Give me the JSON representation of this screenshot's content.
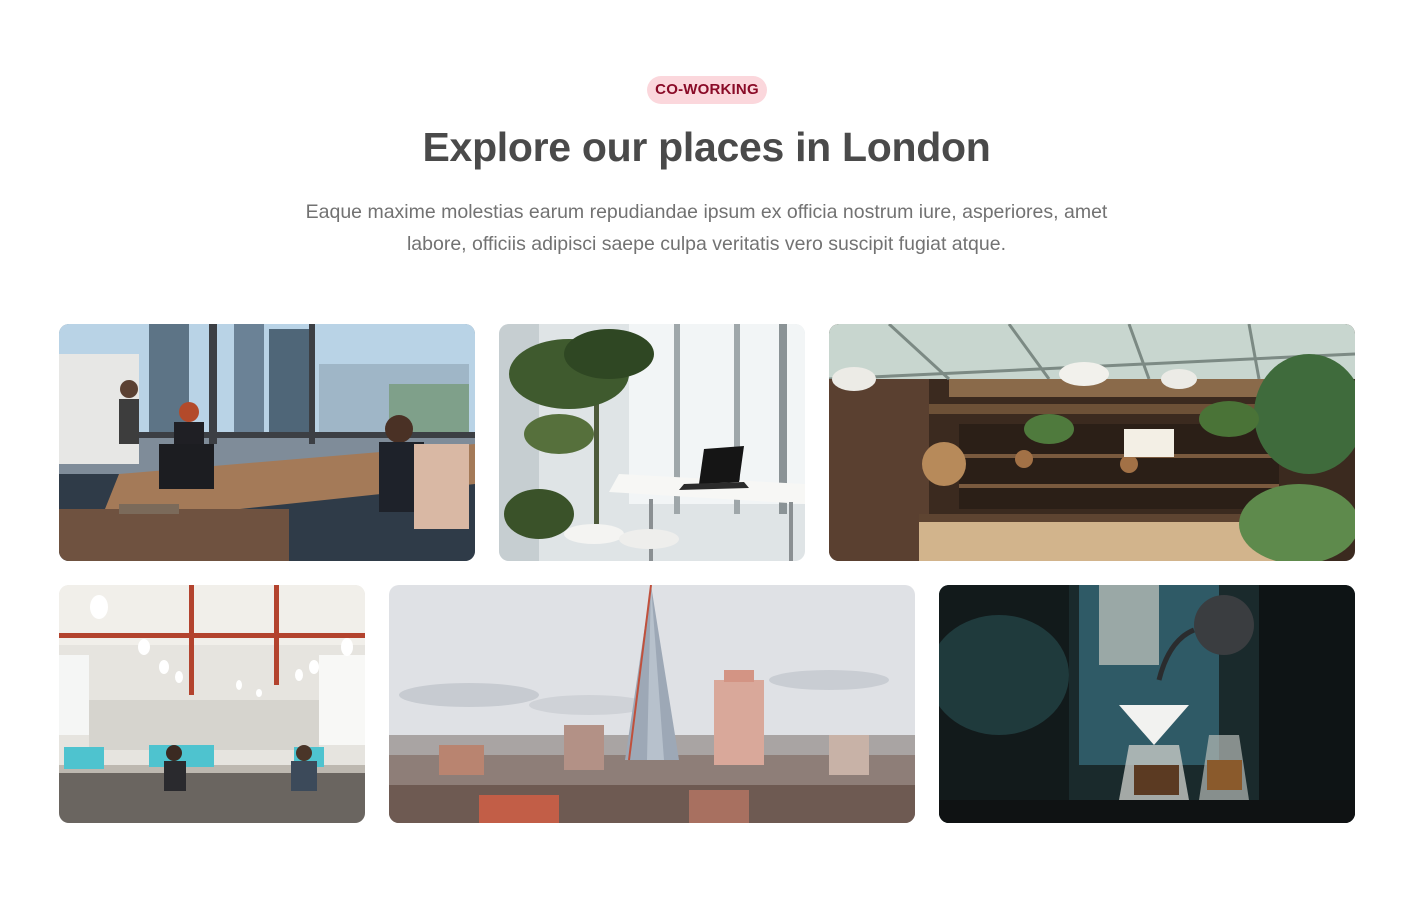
{
  "section": {
    "badge": "CO-WORKING",
    "title": "Explore our places in London",
    "description": "Eaque maxime molestias earum repudiandae ipsum ex officia nostrum iure, asperiores, amet labore, officiis adipisci saepe culpa veritatis vero suscipit fugiat atque."
  },
  "colors": {
    "badge_background": "#fbd7dc",
    "badge_text": "#8a0b27",
    "title": "#4a4a4a",
    "description": "#727272"
  },
  "gallery": {
    "rows": [
      [
        "office-window-photo",
        "plant-desk-photo",
        "cafe-bar-photo"
      ],
      [
        "lights-office-photo",
        "shard-skyline-photo",
        "pour-over-coffee-photo"
      ]
    ]
  }
}
